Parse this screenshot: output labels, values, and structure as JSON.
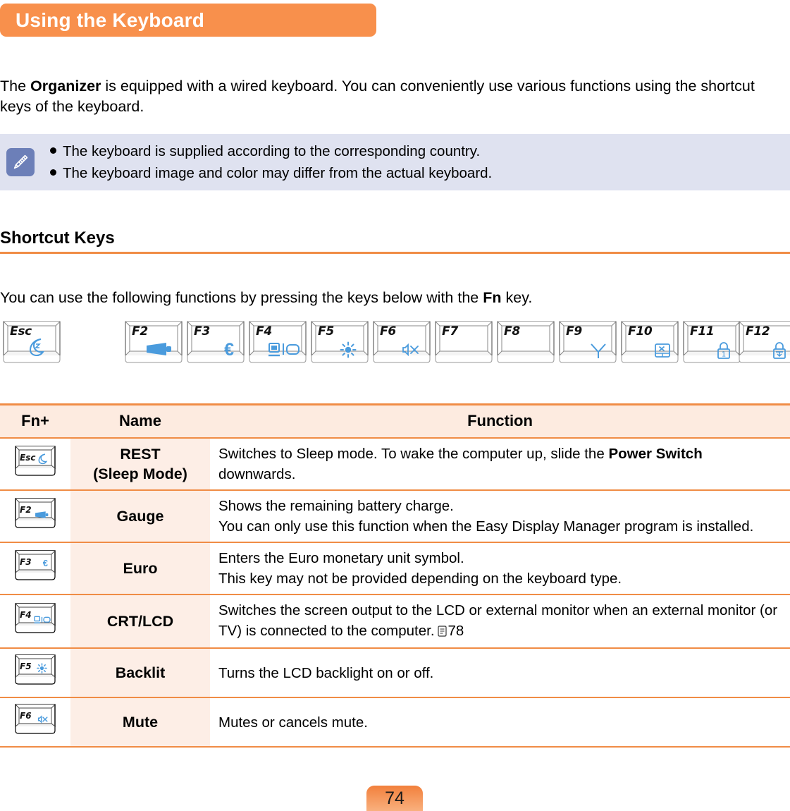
{
  "page": {
    "title": "Using the Keyboard",
    "number": "74"
  },
  "intro": {
    "prefix": "The ",
    "bold": "Organizer",
    "suffix": " is equipped with a wired keyboard. You can conveniently use various functions using the shortcut keys of the keyboard."
  },
  "note": {
    "icon": "pencil-note-icon",
    "items": [
      "The keyboard is supplied according to the corresponding country.",
      "The keyboard image and color may differ from the actual keyboard."
    ]
  },
  "section": {
    "heading": "Shortcut Keys",
    "intro_prefix": "You can use the following functions by pressing the keys below with the ",
    "intro_bold": "Fn",
    "intro_suffix": " key."
  },
  "keyboard_strip": {
    "keys": [
      {
        "label": "Esc",
        "icon": "moon-sleep-icon"
      },
      {
        "label": "F2",
        "icon": "battery-gauge-icon"
      },
      {
        "label": "F3",
        "icon": "euro-icon"
      },
      {
        "label": "F4",
        "icon": "crt-lcd-monitor-icon"
      },
      {
        "label": "F5",
        "icon": "brightness-sun-icon"
      },
      {
        "label": "F6",
        "icon": "mute-speaker-icon"
      },
      {
        "label": "F7",
        "icon": ""
      },
      {
        "label": "F8",
        "icon": ""
      },
      {
        "label": "F9",
        "icon": "wireless-antenna-icon"
      },
      {
        "label": "F10",
        "icon": "touchpad-off-icon"
      },
      {
        "label": "F11",
        "icon": "num-lock-icon"
      },
      {
        "label": "F12",
        "icon": "scroll-lock-icon"
      }
    ]
  },
  "table": {
    "headers": {
      "fn": "Fn+",
      "name": "Name",
      "function": "Function"
    },
    "rows": [
      {
        "key_label": "Esc",
        "key_icon": "moon-sleep-icon",
        "name_line1": "REST",
        "name_line2": "(Sleep Mode)",
        "function_parts": [
          {
            "text": "Switches to Sleep mode. To wake the computer up, slide the ",
            "bold": false
          },
          {
            "text": "Power Switch",
            "bold": true
          },
          {
            "text": " downwards.",
            "bold": false
          }
        ]
      },
      {
        "key_label": "F2",
        "key_icon": "battery-gauge-icon",
        "name_line1": "Gauge",
        "name_line2": "",
        "function_lines": [
          "Shows the remaining battery charge.",
          "You can only use this function when the Easy Display Manager program is installed."
        ]
      },
      {
        "key_label": "F3",
        "key_icon": "euro-icon",
        "name_line1": "Euro",
        "name_line2": "",
        "function_lines": [
          "Enters the Euro monetary unit symbol.",
          "This key may not be provided depending on the keyboard type."
        ]
      },
      {
        "key_label": "F4",
        "key_icon": "crt-lcd-monitor-icon",
        "name_line1": "CRT/LCD",
        "name_line2": "",
        "function_text": "Switches the screen output to the LCD or external monitor when an external monitor (or TV) is connected to the computer.",
        "page_ref": "78"
      },
      {
        "key_label": "F5",
        "key_icon": "brightness-sun-icon",
        "name_line1": "Backlit",
        "name_line2": "",
        "function_text": "Turns the LCD backlight on or off."
      },
      {
        "key_label": "F6",
        "key_icon": "mute-speaker-icon",
        "name_line1": "Mute",
        "name_line2": "",
        "function_text": "Mutes or cancels mute."
      }
    ]
  },
  "colors": {
    "accent_orange": "#F8904C",
    "rule_orange": "#F08C45",
    "note_bg": "#DFE2F0",
    "note_icon_bg": "#6C7FB8",
    "table_header_bg": "#FDEBE0",
    "table_name_bg": "#FDEEE6",
    "key_glyph_blue": "#4A9BDD"
  }
}
